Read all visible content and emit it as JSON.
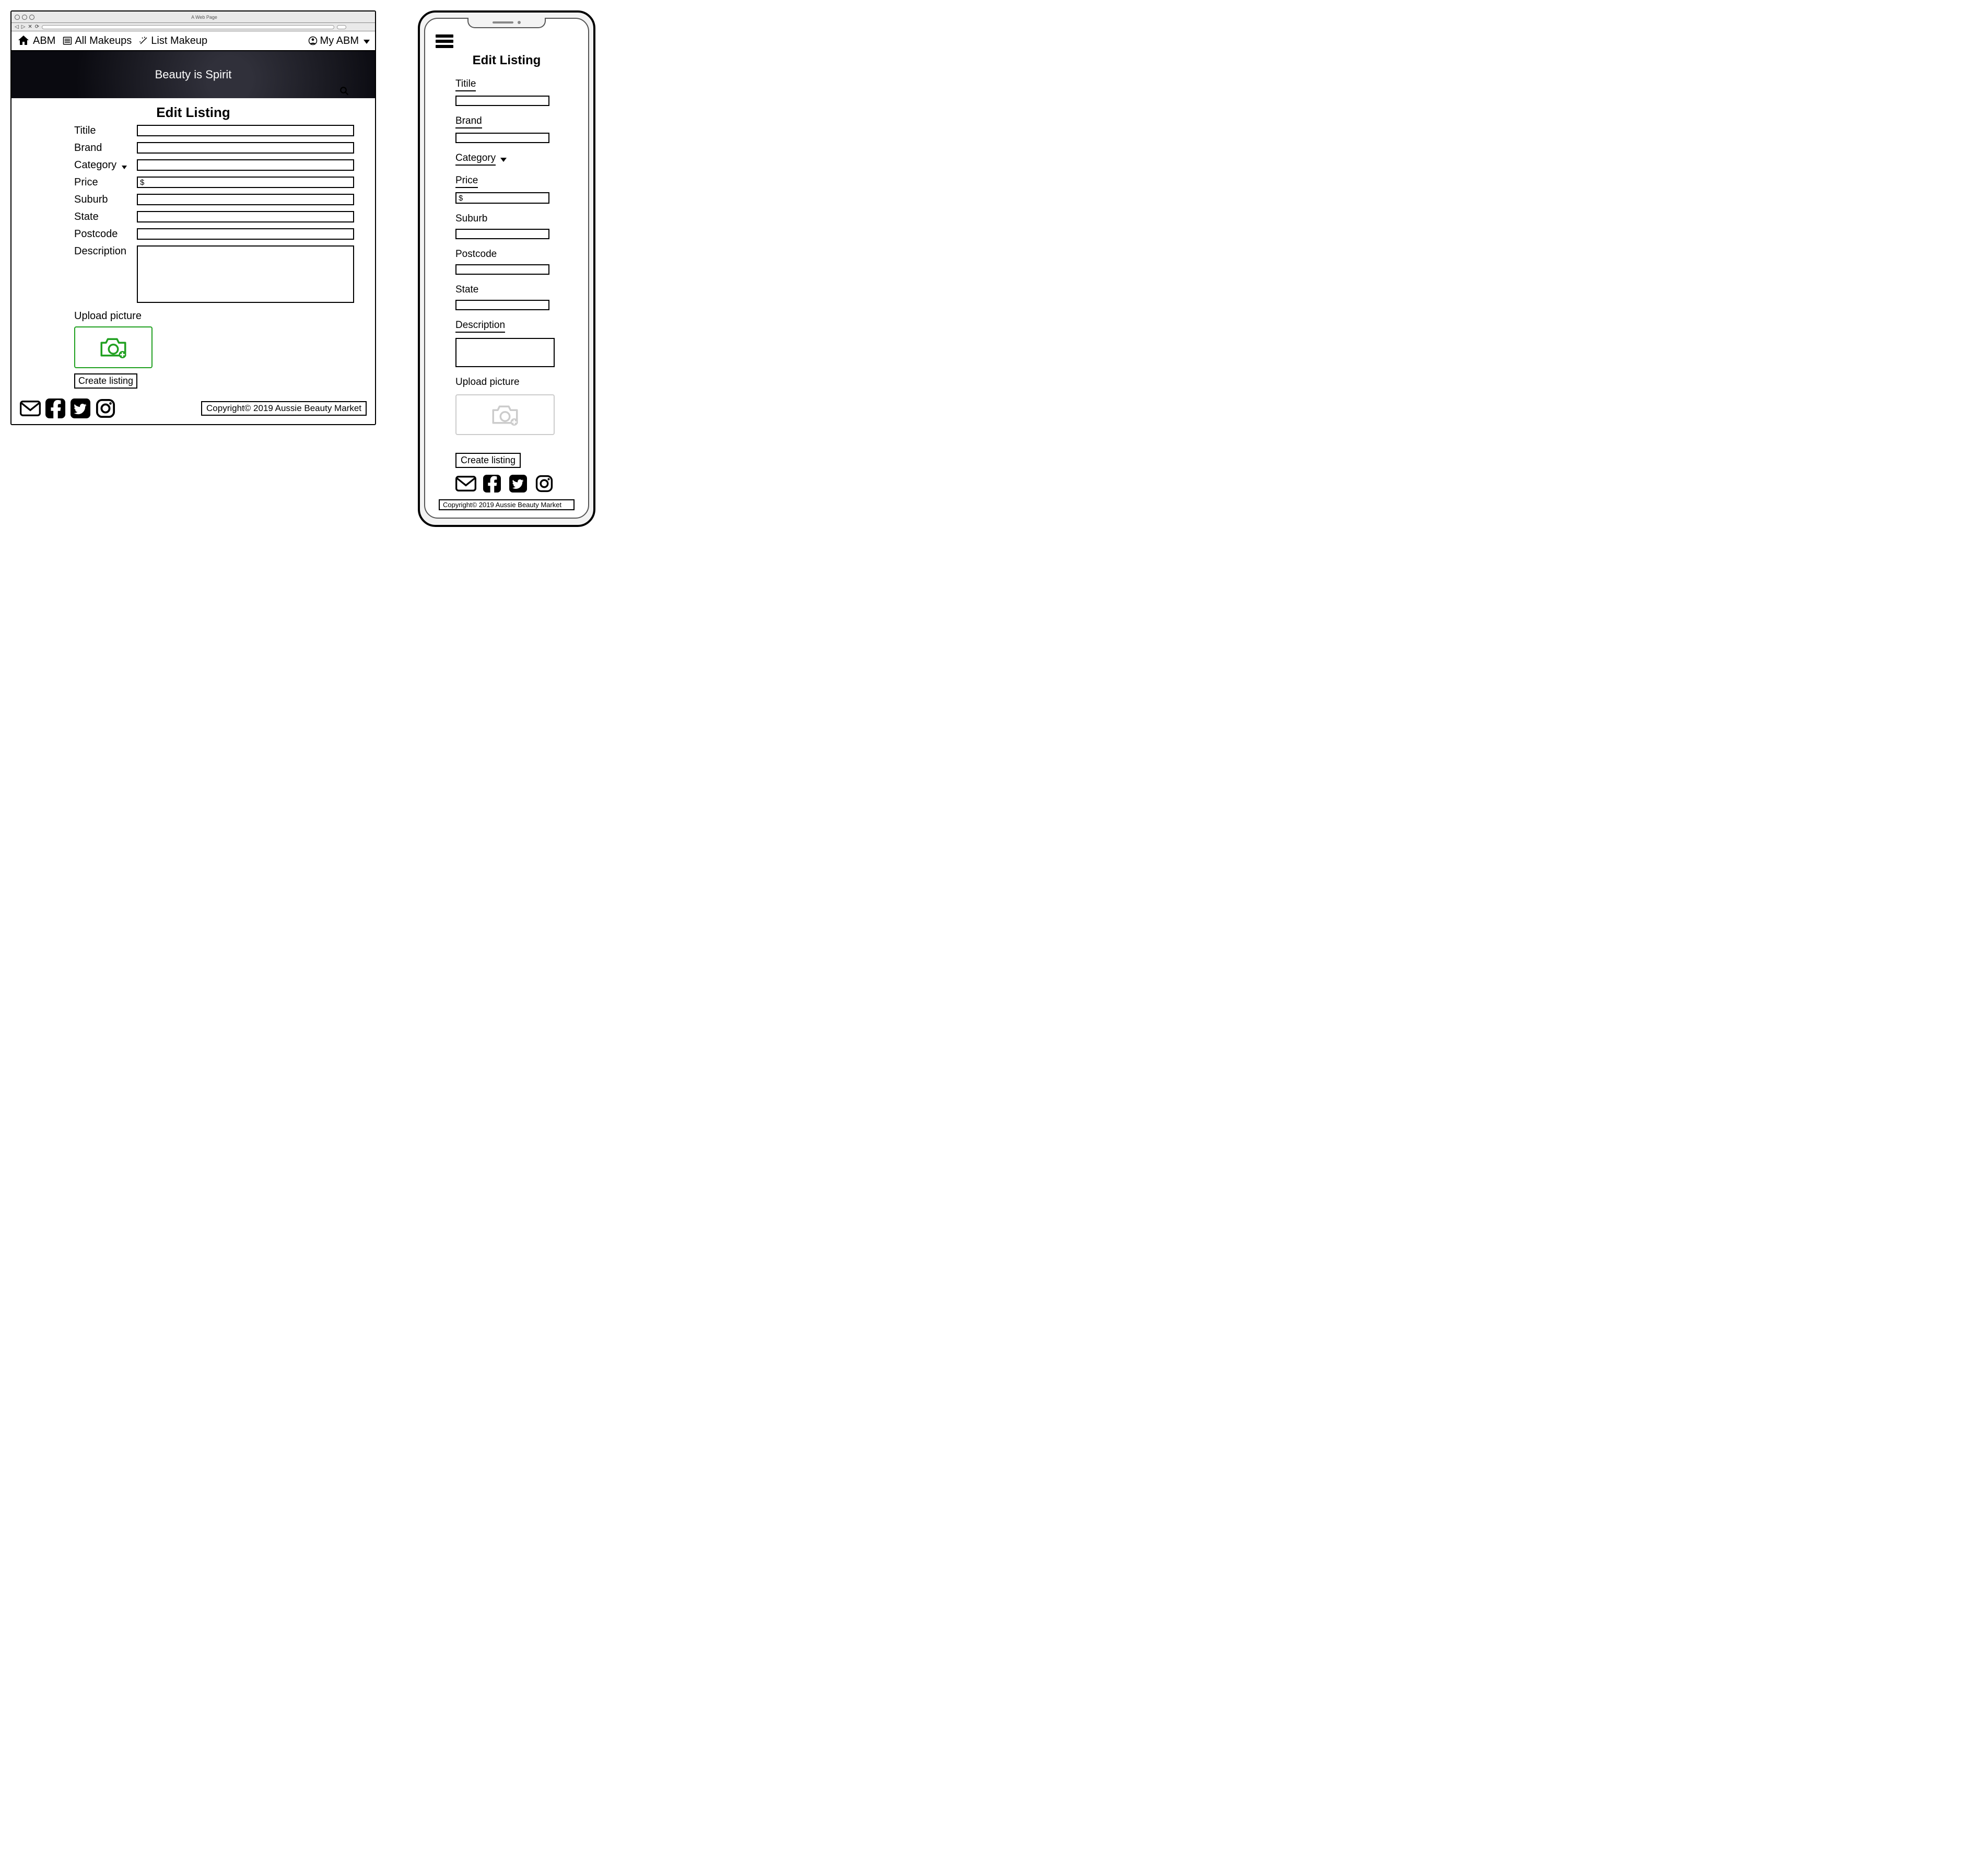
{
  "browser_tab_title": "A Web Page",
  "nav": {
    "brand": "ABM",
    "all_makeups": "All Makeups",
    "list_makeup": "List Makeup",
    "my_abm": "My ABM"
  },
  "banner": "Beauty is Spirit",
  "page_title": "Edit Listing",
  "form": {
    "title": "Titile",
    "brand": "Brand",
    "category": "Category",
    "price_label": "Price",
    "price_prefix": "$",
    "suburb": "Suburb",
    "state": "State",
    "postcode": "Postcode",
    "description": "Description",
    "upload": "Upload picture",
    "create_btn": "Create listing"
  },
  "footer": {
    "copyright": "Copyright© 2019 Aussie Beauty Market"
  },
  "mobile": {
    "page_title": "Edit Listing",
    "title": "Titile",
    "brand": "Brand",
    "category": "Category",
    "price": "Price",
    "price_prefix": "$",
    "suburb": "Suburb",
    "postcode": "Postcode",
    "state": "State",
    "description": "Description",
    "upload": "Upload picture",
    "create_btn": "Create listing",
    "copyright": "Copyright© 2019 Aussie Beauty Market"
  }
}
